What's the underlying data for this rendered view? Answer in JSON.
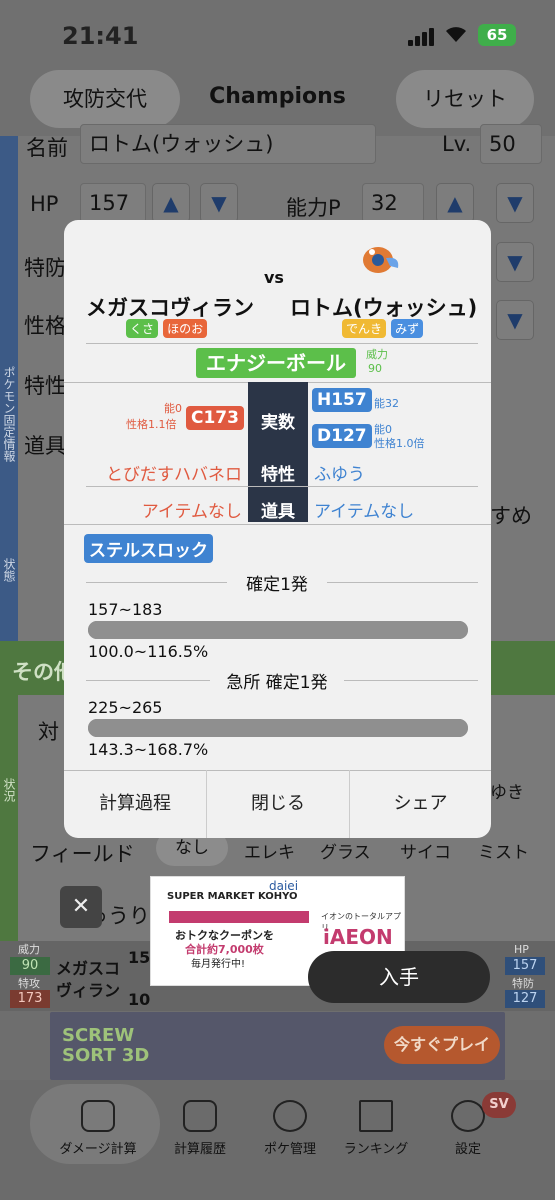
{
  "status_bar": {
    "time": "21:41",
    "battery": "65"
  },
  "header": {
    "left_button": "攻防交代",
    "title": "Champions",
    "right_button": "リセット"
  },
  "sidebar": {
    "fixed_label": "ポケモン固定情報",
    "status_label": "状態",
    "status2_label": "状況"
  },
  "form": {
    "name_label": "名前",
    "name_value": "ロトム(ウォッシュ)",
    "lv_label": "Lv.",
    "lv_value": "50",
    "hp_label": "HP",
    "hp_value": "157",
    "ability_p_label": "能力P",
    "ability_p_value": "32",
    "tokubo_label": "特防",
    "seikaku_label": "性格",
    "tokusei_label": "特性",
    "dougu_label": "道具",
    "osusume": "すめ",
    "sono_label": "その他",
    "tai_label": "対",
    "field_label": "フィールド",
    "field_options": [
      "なし",
      "エレキ",
      "グラス",
      "サイコ",
      "ミスト"
    ],
    "yuki_label": "ゆき",
    "juuri_label": "じゅうり"
  },
  "modal": {
    "attacker": {
      "name": "メガスコヴィラン",
      "types": [
        {
          "label": "くさ",
          "color": "#5cbf4a"
        },
        {
          "label": "ほのお",
          "color": "#e8663a"
        }
      ]
    },
    "vs": "vs",
    "defender": {
      "name": "ロトム(ウォッシュ)",
      "types": [
        {
          "label": "でんき",
          "color": "#f0b933"
        },
        {
          "label": "みず",
          "color": "#4a8fe0"
        }
      ]
    },
    "move": {
      "name": "エナジーボール",
      "power_label": "威力",
      "power": "90"
    },
    "stat_header": "実数",
    "atk_note1": "能0",
    "atk_note2": "性格1.1倍",
    "atk_stat": "C173",
    "def_hp": "H157",
    "def_hp_note": "能32",
    "def_stat": "D127",
    "def_note1": "能0",
    "def_note2": "性格1.0倍",
    "ability_header": "特性",
    "atk_ability": "とびだすハバネロ",
    "def_ability": "ふゆう",
    "item_header": "道具",
    "atk_item": "アイテムなし",
    "def_item": "アイテムなし",
    "stealth_rock": "ステルスロック",
    "normal": {
      "label": "確定1発",
      "range": "157~183",
      "percent": "100.0~116.5%",
      "fill": 1.0
    },
    "crit": {
      "label": "急所 確定1発",
      "range": "225~265",
      "percent": "143.3~168.7%",
      "fill": 1.0
    },
    "buttons": {
      "calc": "計算過程",
      "close": "閉じる",
      "share": "シェア"
    }
  },
  "infobar": {
    "left_power_label": "威力",
    "left_power": "90",
    "left_atk_label": "特攻",
    "left_atk": "173",
    "left_name_1": "メガスコ",
    "left_name_2": "ヴィラン",
    "mid_top": "15",
    "mid_bottom": "10",
    "right_hp_label": "HP",
    "right_hp": "157",
    "right_def_label": "特防",
    "right_def": "127"
  },
  "ads": {
    "banner_game": "SCREW SORT 3D",
    "banner_cta": "今すぐプレイ",
    "store1": "SUPER MARKET KOHYO",
    "store2": "daiei",
    "coupon1": "おトクなクーポンを",
    "coupon2": "合計約7,000枚",
    "coupon3": "毎月発行中!",
    "app_tag": "イオンのトータルアプリ",
    "app_name": "iAEON",
    "get_button": "入手"
  },
  "tabbar": {
    "items": [
      "ダメージ計算",
      "計算履歴",
      "ポケ管理",
      "ランキング",
      "設定"
    ],
    "badge": "SV"
  }
}
